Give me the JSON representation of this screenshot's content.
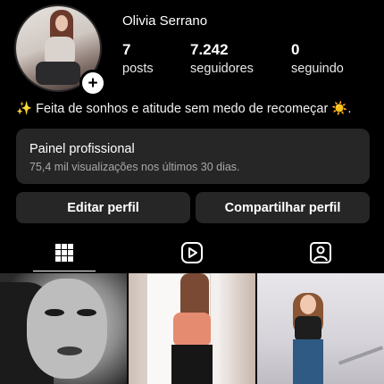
{
  "profile": {
    "username": "Olivia Serrano",
    "stats": [
      {
        "value": "7",
        "label": "posts"
      },
      {
        "value": "7.242",
        "label": "seguidores"
      },
      {
        "value": "0",
        "label": "seguindo"
      }
    ],
    "bio": "✨ Feita de sonhos e atitude sem medo de recomeçar ☀️."
  },
  "panel": {
    "title": "Painel profissional",
    "subtitle": "75,4 mil visualizações nos últimos 30 dias."
  },
  "buttons": {
    "edit": "Editar perfil",
    "share": "Compartilhar perfil"
  },
  "tabs": [
    {
      "icon": "grid-icon",
      "active": true
    },
    {
      "icon": "reels-icon",
      "active": false
    },
    {
      "icon": "tagged-icon",
      "active": false
    }
  ],
  "posts": [
    {
      "type": "photo",
      "tone": "grayscale"
    },
    {
      "type": "photo",
      "tone": "color"
    },
    {
      "type": "photo",
      "tone": "color"
    }
  ],
  "colors": {
    "background": "#000000",
    "surface": "#262626",
    "text": "#ffffff",
    "muted": "#a8a8a8"
  }
}
